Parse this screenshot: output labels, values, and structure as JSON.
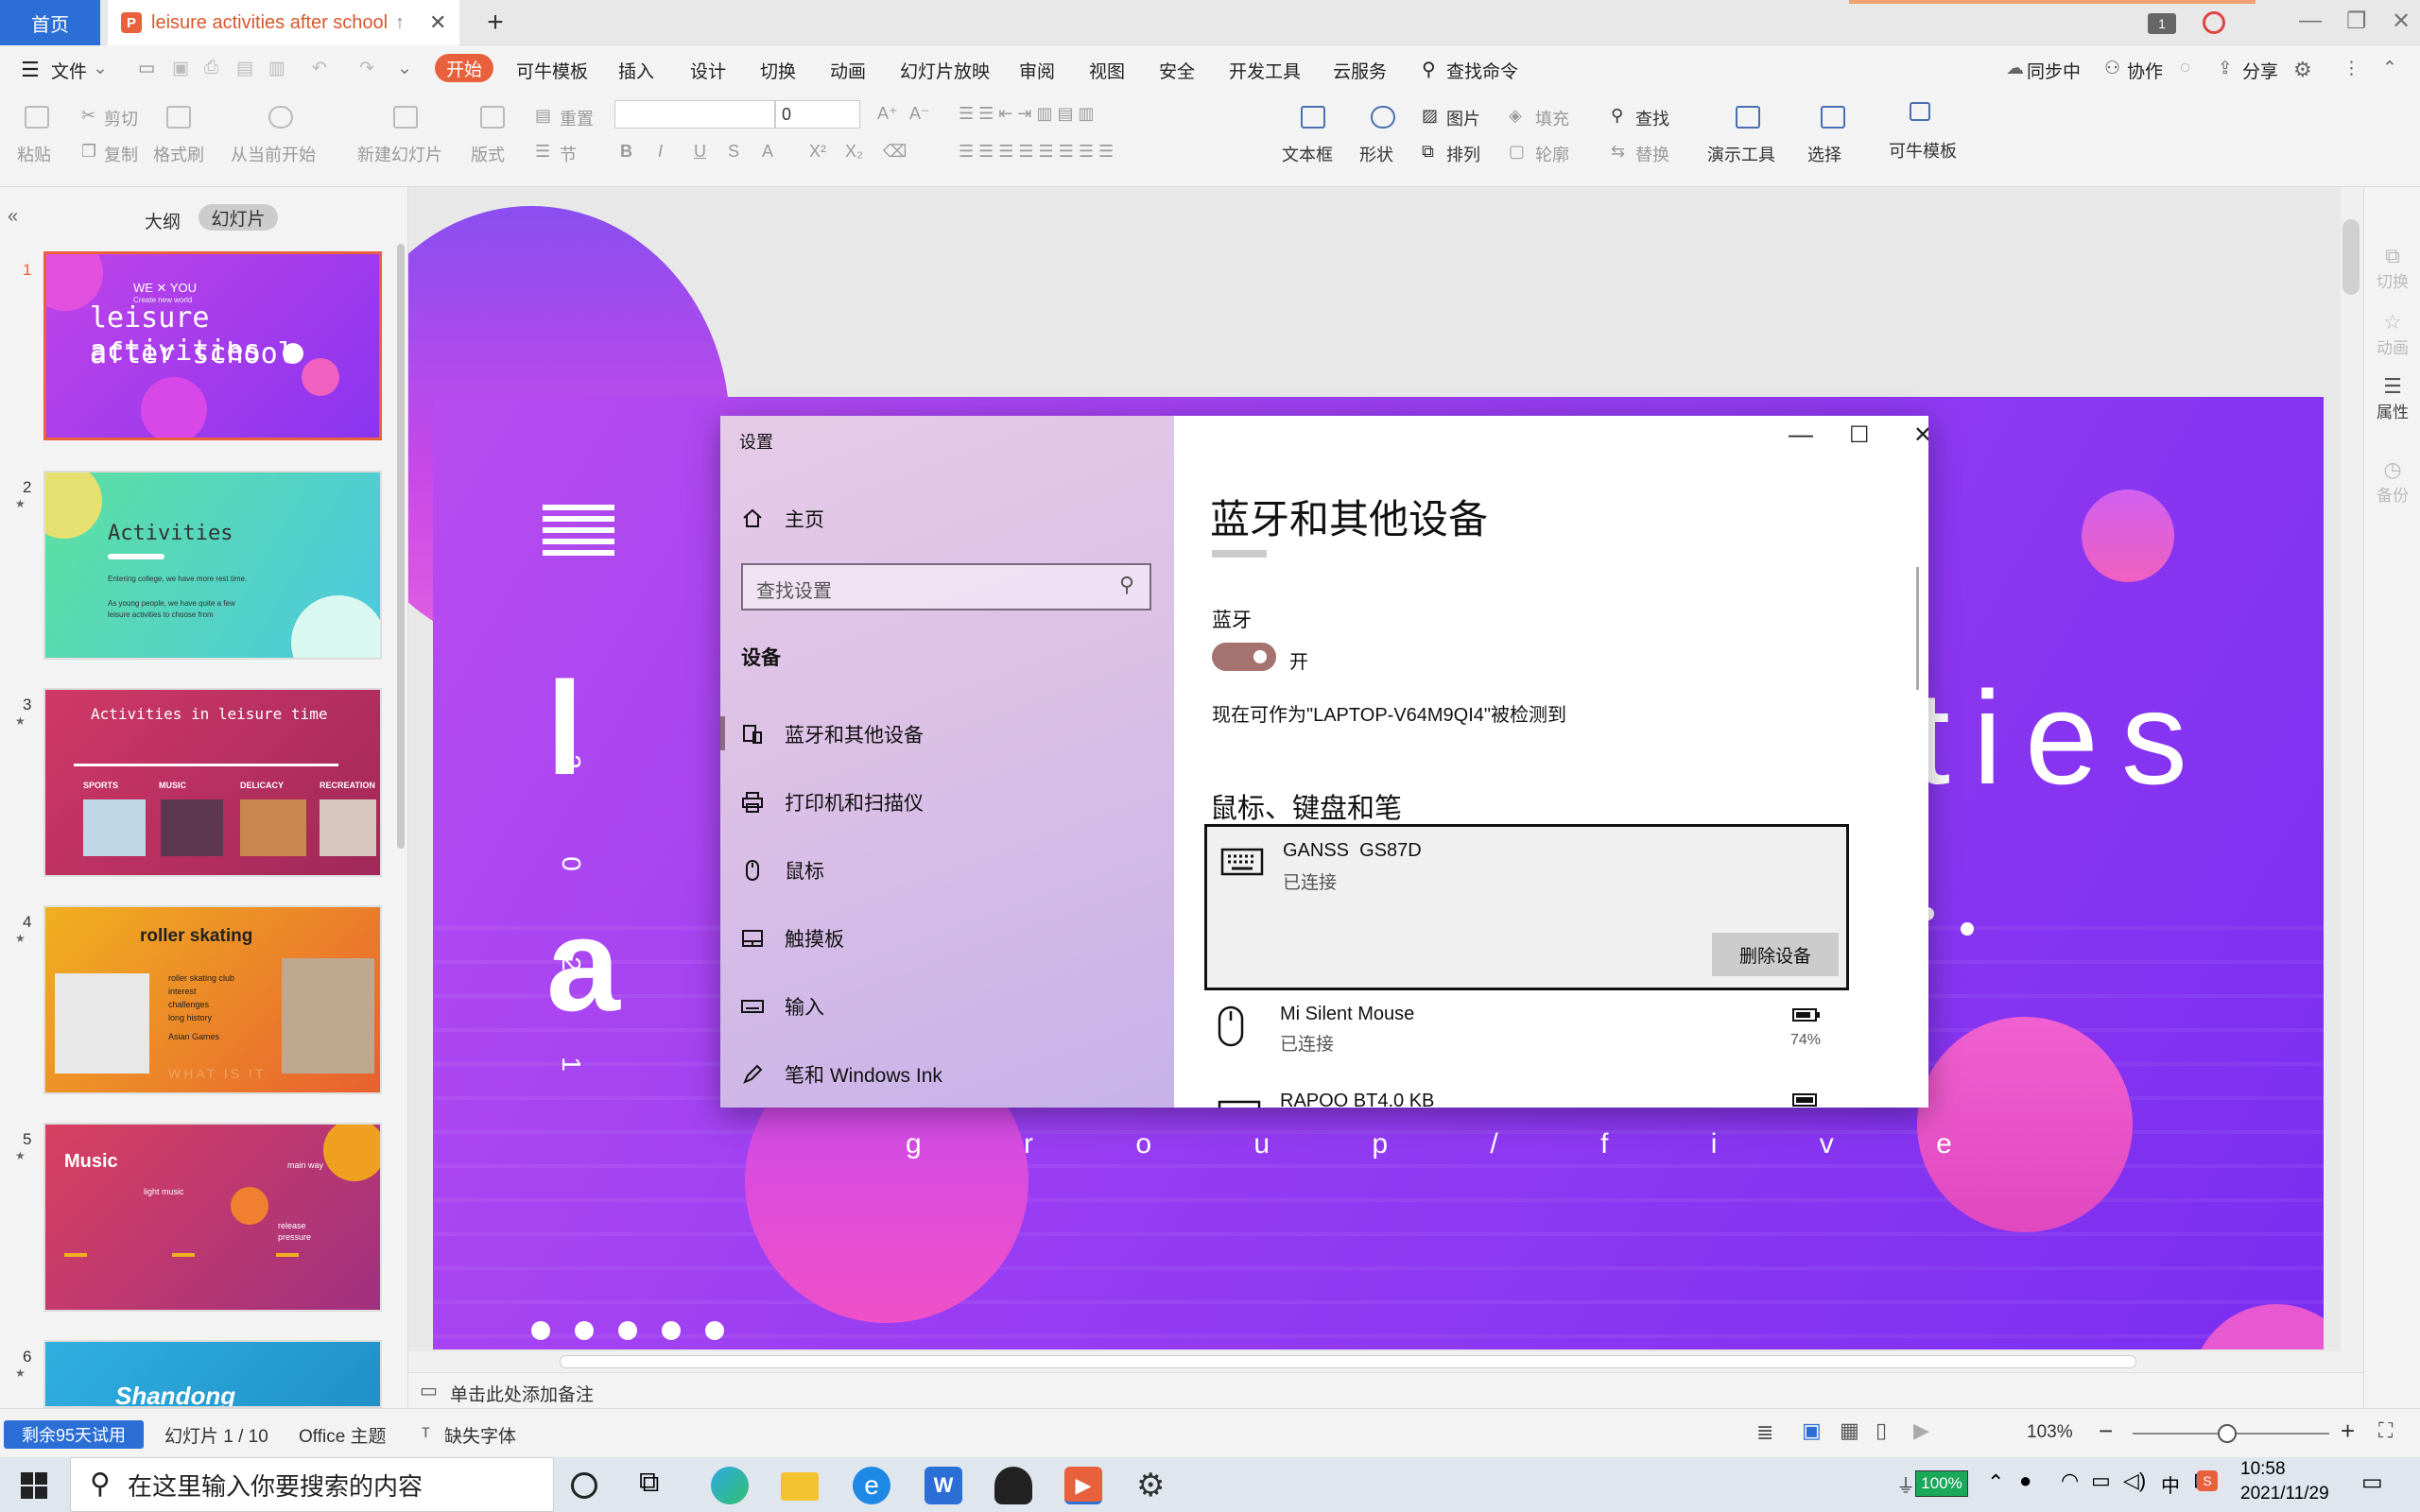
{
  "tabs": {
    "home": "首页",
    "document": "leisure activities after school"
  },
  "menu": {
    "file": "文件",
    "items": [
      "开始",
      "可牛模板",
      "插入",
      "设计",
      "切换",
      "动画",
      "幻灯片放映",
      "审阅",
      "视图",
      "安全",
      "开发工具",
      "云服务"
    ],
    "search_cmd": "查找命令",
    "right": {
      "sync": "同步中",
      "collab": "协作",
      "share": "分享"
    }
  },
  "ribbon": {
    "paste": "粘贴",
    "cut": "剪切",
    "copy": "复制",
    "format_painter": "格式刷",
    "from_current": "从当前开始",
    "new_slide": "新建幻灯片",
    "layout": "版式",
    "reset": "重置",
    "section": "节",
    "font_size": "0",
    "textbox": "文本框",
    "shape": "形状",
    "picture": "图片",
    "arrange": "排列",
    "fill": "填充",
    "outline": "轮廓",
    "find": "查找",
    "replace": "替换",
    "presentation_tools": "演示工具",
    "select": "选择",
    "template": "可牛模板"
  },
  "left_panel": {
    "outline_label": "大纲",
    "slides_label": "幻灯片",
    "slide_numbers": [
      "1",
      "2",
      "3",
      "4",
      "5",
      "6"
    ],
    "thumbs": {
      "t1": {
        "we_you": "WE ✕ YOU",
        "sub": "Create new world",
        "title1": "leisure activities",
        "title2": "after school"
      },
      "t2": {
        "title": "Activities",
        "l1": "Entering college, we have more rest time.",
        "l2": "As young people, we have quite a few",
        "l3": "leisure activities to choose from"
      },
      "t3": {
        "title": "Activities in leisure time",
        "labels": [
          "SPORTS",
          "MUSIC",
          "DELICACY",
          "RECREATION"
        ]
      },
      "t4": {
        "title": "roller skating",
        "lines": [
          "roller skating club",
          "interest",
          "challenges",
          "long history",
          "Asian Games"
        ],
        "footer": "WHAT IS IT"
      },
      "t5": {
        "title": "Music",
        "light": "light music",
        "main": "main way",
        "release": "release",
        "pressure": "pressure"
      },
      "t6": {
        "title": "Shandong"
      }
    }
  },
  "slide": {
    "year": [
      "2",
      "0",
      "2",
      "1"
    ],
    "title_partial": "ties",
    "letter_l": "l",
    "letter_a": "a",
    "group": "g r o u p / f i v e"
  },
  "settings_window": {
    "title": "设置",
    "nav": {
      "home": "主页",
      "search_placeholder": "查找设置",
      "section": "设备",
      "items": [
        "蓝牙和其他设备",
        "打印机和扫描仪",
        "鼠标",
        "触摸板",
        "输入",
        "笔和 Windows Ink"
      ]
    },
    "content": {
      "heading": "蓝牙和其他设备",
      "bt_label": "蓝牙",
      "toggle_state": "开",
      "discoverable": "现在可作为\"LAPTOP-V64M9QI4\"被检测到",
      "section": "鼠标、键盘和笔",
      "devices": [
        {
          "name": "GANSS  GS87D",
          "status": "已连接",
          "action": "删除设备"
        },
        {
          "name": "Mi Silent Mouse",
          "status": "已连接",
          "battery": "74%"
        },
        {
          "name": "RAPOO BT4.0 KB"
        }
      ]
    }
  },
  "notes": {
    "placeholder": "单击此处添加备注"
  },
  "status": {
    "trial": "剩余95天试用",
    "slide_count": "幻灯片 1 / 10",
    "theme": "Office 主题",
    "missing_font": "缺失字体",
    "zoom": "103%"
  },
  "right_rail": {
    "transition": "切换",
    "animation": "动画",
    "properties": "属性",
    "backup": "备份"
  },
  "taskbar": {
    "search": "在这里输入你要搜索的内容",
    "battery": "100%",
    "time": "10:58",
    "date": "2021/11/29",
    "ime": "中",
    "tray_num": "1"
  }
}
